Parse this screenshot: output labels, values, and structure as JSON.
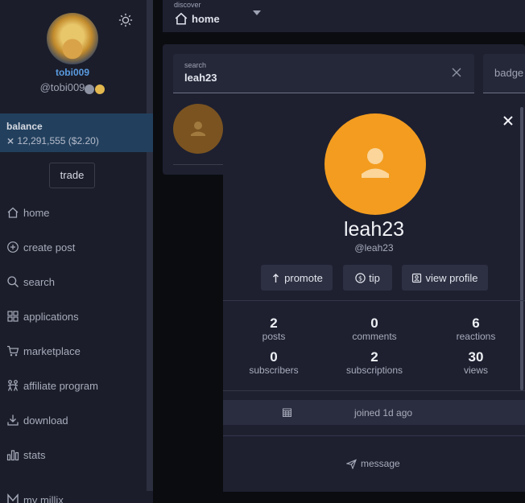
{
  "sidebar": {
    "username": "tobi009",
    "handle": "@tobi009",
    "balance_title": "balance",
    "balance_value": "12,291,555 ($2.20)",
    "trade_label": "trade",
    "nav": [
      {
        "label": "home",
        "icon": "home-icon"
      },
      {
        "label": "create post",
        "icon": "plus-circle-icon"
      },
      {
        "label": "search",
        "icon": "search-icon"
      },
      {
        "label": "applications",
        "icon": "grid-icon"
      },
      {
        "label": "marketplace",
        "icon": "cart-icon"
      },
      {
        "label": "affiliate program",
        "icon": "people-icon"
      },
      {
        "label": "download",
        "icon": "download-icon"
      },
      {
        "label": "stats",
        "icon": "bar-chart-icon"
      },
      {
        "label": "my millix",
        "icon": "millix-icon"
      }
    ]
  },
  "topbar": {
    "discover_label": "discover",
    "discover_value": "home"
  },
  "search": {
    "label": "search",
    "value": "leah23",
    "badge_label": "badge"
  },
  "profile": {
    "name": "leah23",
    "handle": "@leah23",
    "buttons": {
      "promote": "promote",
      "tip": "tip",
      "view_profile": "view profile"
    },
    "stats": [
      {
        "value": "2",
        "label": "posts"
      },
      {
        "value": "0",
        "label": "comments"
      },
      {
        "value": "6",
        "label": "reactions"
      },
      {
        "value": "0",
        "label": "subscribers"
      },
      {
        "value": "2",
        "label": "subscriptions"
      },
      {
        "value": "30",
        "label": "views"
      }
    ],
    "joined": "joined 1d ago",
    "message": "message"
  },
  "colors": {
    "accent": "#5a9be0",
    "avatar": "#f39c1f",
    "balance_bg": "#22405e"
  }
}
